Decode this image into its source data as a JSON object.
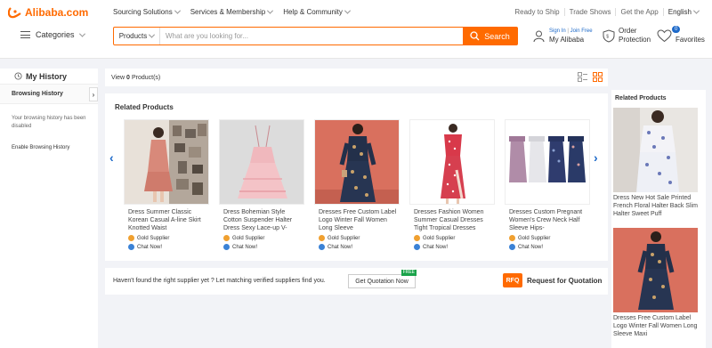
{
  "brand": {
    "name": "Alibaba.com",
    "color": "#ff6a00"
  },
  "topnav": [
    {
      "label": "Sourcing Solutions"
    },
    {
      "label": "Services & Membership"
    },
    {
      "label": "Help & Community"
    }
  ],
  "toplinks": {
    "ready": "Ready to Ship",
    "trade": "Trade Shows",
    "app": "Get the App",
    "lang": "English"
  },
  "categories_label": "Categories",
  "search": {
    "type": "Products",
    "placeholder": "What are you looking for...",
    "button": "Search"
  },
  "account": {
    "signin": "Sign In",
    "sep": "|",
    "join": "Join Free",
    "my": "My Alibaba"
  },
  "order": {
    "line1": "Order",
    "line2": "Protection"
  },
  "favorites": {
    "count": "0",
    "label": "Favorites"
  },
  "history": {
    "title": "My History",
    "tab": "Browsing History",
    "note": "Your browsing history has been disabled",
    "enable": "Enable Browsing History"
  },
  "viewbar": {
    "prefix": "View",
    "count": "0",
    "suffix": "Product(s)"
  },
  "related": {
    "title": "Related Products",
    "products": [
      {
        "title": "Dress Summer Classic Korean Casual A-line Skirt Knotted Waist",
        "supplier": "Gold Supplier",
        "chat": "Chat Now!"
      },
      {
        "title": "Dress Bohemian Style Cotton Suspender Halter Dress Sexy Lace-up V-",
        "supplier": "Gold Supplier",
        "chat": "Chat Now!"
      },
      {
        "title": "Dresses Free Custom Label Logo Winter Fall Women Long Sleeve",
        "supplier": "Gold Supplier",
        "chat": "Chat Now!"
      },
      {
        "title": "Dresses Fashion Women Summer Casual Dresses Tight Tropical Dresses",
        "supplier": "Gold Supplier",
        "chat": "Chat Now!"
      },
      {
        "title": "Dresses Custom Pregnant Women's Crew Neck Half Sleeve Hips-",
        "supplier": "Gold Supplier",
        "chat": "Chat Now!"
      }
    ]
  },
  "rfq": {
    "text": "Haven't found the right supplier yet ? Let matching verified suppliers find you.",
    "button": "Get Quotation Now",
    "free": "FREE",
    "badge": "RFQ",
    "label": "Request for Quotation"
  },
  "rightbar": {
    "title": "Related Products",
    "items": [
      {
        "name": "Dress New Hot Sale Printed French Floral Halter Back Slim Halter Sweet Puff"
      },
      {
        "name": "Dresses Free Custom Label Logo Winter Fall Women Long Sleeve Maxi"
      }
    ]
  }
}
